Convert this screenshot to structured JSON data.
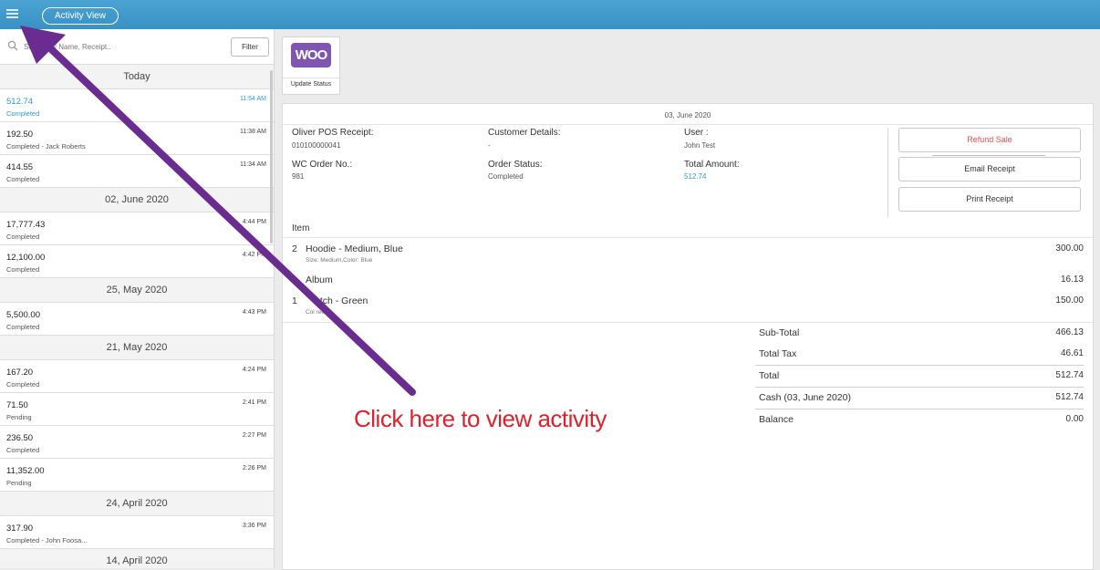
{
  "header": {
    "activity_view_label": "Activity View",
    "bg_color": "#3a91c4"
  },
  "search": {
    "placeholder": "Search by Name, Receipt..",
    "filter_label": "Filter"
  },
  "activity_groups": [
    {
      "date": "Today",
      "entries": [
        {
          "amount": "512.74",
          "status": "Completed",
          "time": "11:54 AM",
          "active": true
        },
        {
          "amount": "192.50",
          "status": "Completed - Jack Roberts",
          "time": "11:38 AM"
        },
        {
          "amount": "414.55",
          "status": "Completed",
          "time": "11:34 AM"
        }
      ]
    },
    {
      "date": "02, June 2020",
      "entries": [
        {
          "amount": "17,777.43",
          "status": "Completed",
          "time": "4:44 PM"
        },
        {
          "amount": "12,100.00",
          "status": "Completed",
          "time": "4:42 PM"
        }
      ]
    },
    {
      "date": "25, May 2020",
      "entries": [
        {
          "amount": "5,500.00",
          "status": "Completed",
          "time": "4:43 PM"
        }
      ]
    },
    {
      "date": "21, May 2020",
      "entries": [
        {
          "amount": "167.20",
          "status": "Completed",
          "time": "4:24 PM"
        },
        {
          "amount": "71.50",
          "status": "Pending",
          "time": "2:41 PM"
        },
        {
          "amount": "236.50",
          "status": "Completed",
          "time": "2:27 PM"
        },
        {
          "amount": "11,352.00",
          "status": "Pending",
          "time": "2:26 PM"
        }
      ]
    },
    {
      "date": "24, April 2020",
      "entries": [
        {
          "amount": "317.90",
          "status": "Completed - John Foosa...",
          "time": "3:36 PM"
        }
      ]
    },
    {
      "date": "14, April 2020",
      "entries": []
    }
  ],
  "woo": {
    "logo_text": "WOO",
    "update_status_label": "Update Status",
    "brand_color": "#7f54b3"
  },
  "receipt": {
    "date": "03, June 2020",
    "pos_receipt_label": "Oliver POS Receipt:",
    "pos_receipt_value": "010100000041",
    "customer_label": "Customer Details:",
    "customer_value": "-",
    "user_label": "User :",
    "user_value": "John Test",
    "wc_order_label": "WC Order No.:",
    "wc_order_value": "981",
    "order_status_label": "Order Status:",
    "order_status_value": "Completed",
    "total_amount_label": "Total Amount:",
    "total_amount_value": "512.74",
    "refund_label": "Refund Sale",
    "email_label": "Email Receipt",
    "print_label": "Print Receipt",
    "item_header": "Item",
    "items": [
      {
        "qty": "2",
        "name": "Hoodie - Medium, Blue",
        "meta": "Size: Medium,Color: Blue",
        "price": "300.00"
      },
      {
        "qty": "",
        "name": "Album",
        "meta": "",
        "price": "16.13"
      },
      {
        "qty": "1",
        "name": "atch - Green",
        "meta": "Col  reen",
        "price": "150.00"
      }
    ],
    "totals": [
      {
        "label": "Sub-Total",
        "value": "466.13"
      },
      {
        "label": "Total Tax",
        "value": "46.61"
      },
      {
        "label": "Total",
        "value": "512.74"
      },
      {
        "label": "Cash (03, June 2020)",
        "value": "512.74"
      },
      {
        "label": "Balance",
        "value": "0.00"
      }
    ]
  },
  "annotation": {
    "text": "Click here to view activity",
    "arrow_color": "#6a2c91"
  }
}
